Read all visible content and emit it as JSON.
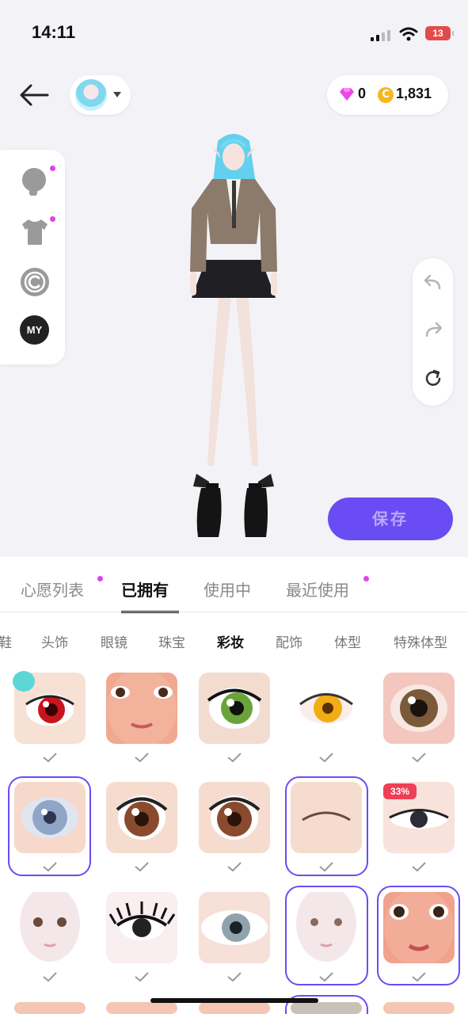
{
  "status_bar": {
    "time": "14:11",
    "battery": "13"
  },
  "header": {
    "back_icon": "arrow-left-icon",
    "gems": "0",
    "coins": "1,831",
    "coin_symbol": "C"
  },
  "side_panel": {
    "items": [
      {
        "icon": "head-icon",
        "dot": true
      },
      {
        "icon": "shirt-icon",
        "dot": true
      },
      {
        "icon": "copyright-icon",
        "dot": false
      },
      {
        "icon": "my-icon",
        "label": "MY",
        "dot": false
      }
    ]
  },
  "right_panel": {
    "items": [
      "undo-icon",
      "redo-icon",
      "refresh-icon"
    ]
  },
  "save_label": "保存",
  "tabs": [
    {
      "label": "心愿列表",
      "dot": true,
      "active": false
    },
    {
      "label": "已拥有",
      "dot": false,
      "active": true
    },
    {
      "label": "使用中",
      "dot": false,
      "active": false
    },
    {
      "label": "最近使用",
      "dot": true,
      "active": false
    }
  ],
  "subtabs": [
    {
      "label": "鞋",
      "active": false
    },
    {
      "label": "头饰",
      "active": false
    },
    {
      "label": "眼镜",
      "active": false
    },
    {
      "label": "珠宝",
      "active": false
    },
    {
      "label": "彩妆",
      "active": true
    },
    {
      "label": "配饰",
      "active": false
    },
    {
      "label": "体型",
      "active": false
    },
    {
      "label": "特殊体型",
      "active": false
    }
  ],
  "grid_badge": "33%",
  "colors": {
    "accent": "#6a4cf4",
    "dot": "#e141e9",
    "badge": "#f03e56"
  }
}
